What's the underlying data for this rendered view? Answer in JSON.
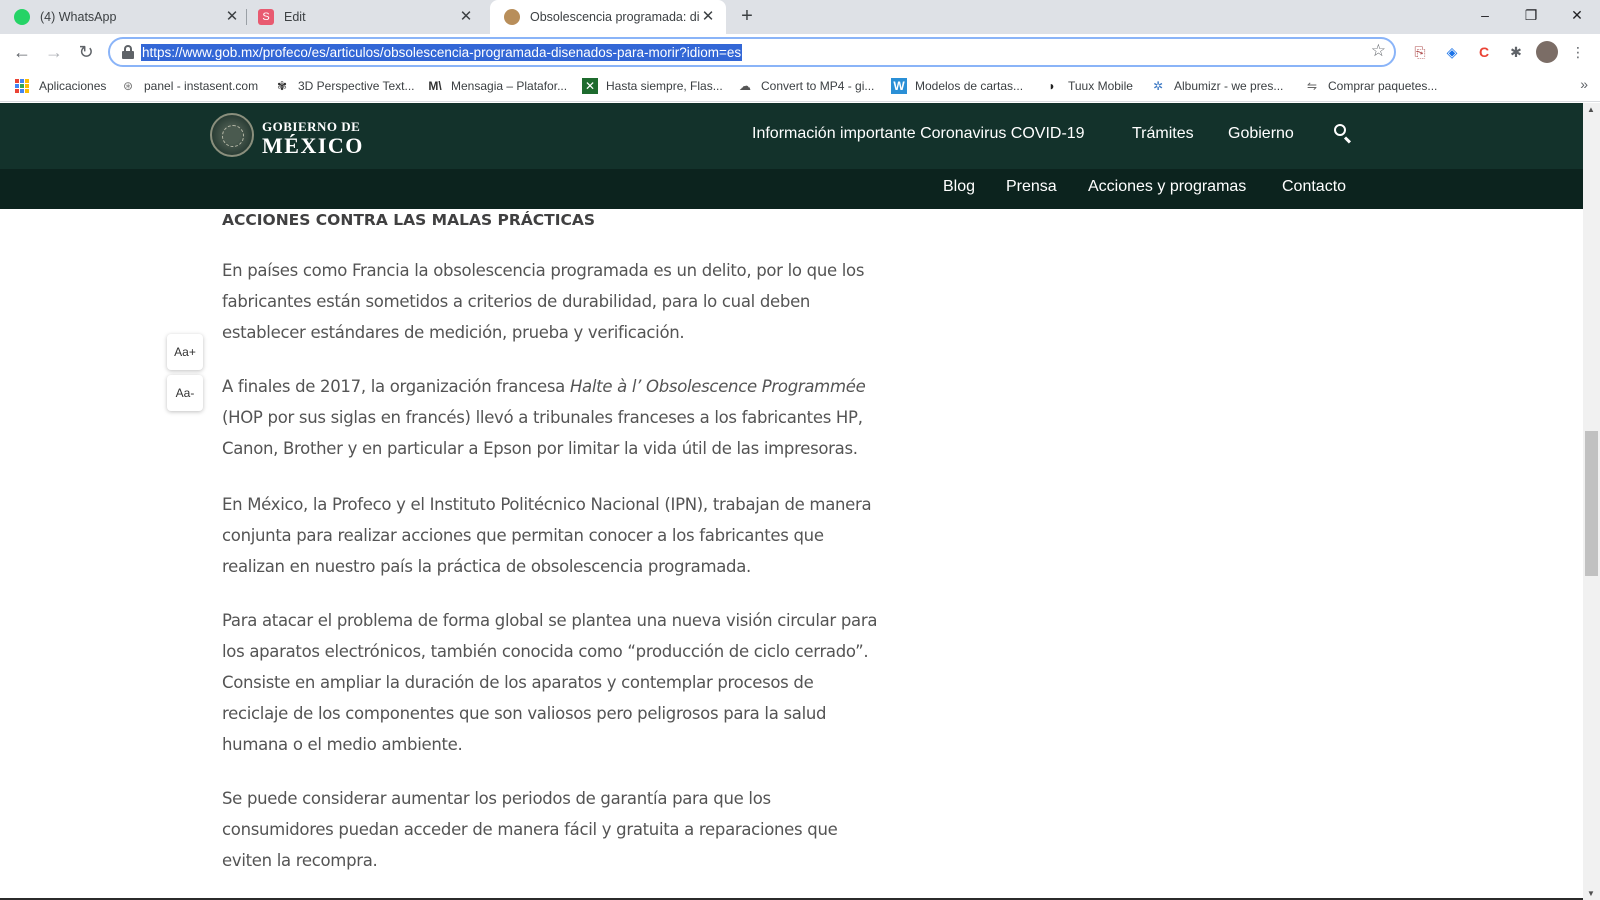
{
  "browser": {
    "tabs": [
      {
        "title": "(4) WhatsApp",
        "icon": "whatsapp-icon",
        "color": "#25d366"
      },
      {
        "title": "Edit",
        "icon": "s-logo-icon",
        "color": "#e85a70"
      },
      {
        "title": "Obsolescencia programada: dise",
        "icon": "profeco-icon",
        "color": "#b88e5a"
      }
    ],
    "new_tab": "+",
    "window_controls": {
      "minimize": "–",
      "restore": "❐",
      "close": "✕"
    },
    "nav": {
      "back": "←",
      "forward": "→",
      "reload": "↻"
    },
    "url": "https://www.gob.mx/profeco/es/articulos/obsolescencia-programada-disenados-para-morir?idiom=es",
    "bookmark_star": "☆",
    "menu": "⋮",
    "bookmarks": [
      "Aplicaciones",
      "panel - instasent.com",
      "3D Perspective Text...",
      "Mensagia – Platafor...",
      "Hasta siempre, Flas...",
      "Convert to MP4 - gi...",
      "Modelos de cartas...",
      "Tuux Mobile",
      "Albumizr - we pres...",
      "Comprar paquetes..."
    ],
    "bookmarks_more": "»"
  },
  "site": {
    "brand_small": "GOBIERNO DE",
    "brand_big": "MÉXICO",
    "top_nav": [
      "Información importante Coronavirus COVID-19",
      "Trámites",
      "Gobierno"
    ],
    "sub_nav": [
      "Blog",
      "Prensa",
      "Acciones y programas",
      "Contacto"
    ],
    "colors": {
      "header": "#13322b",
      "subheader": "#0c231e"
    }
  },
  "article": {
    "heading": "ACCIONES CONTRA LAS MALAS PRÁCTICAS",
    "p1": "En países como Francia la obsolescencia programada es un delito, por lo que los fabricantes están sometidos a criterios de durabilidad, para lo cual deben establecer estándares de medición, prueba y verificación.",
    "p2_before": "A finales de 2017, la organización francesa ",
    "p2_em": "Halte à l’ Obsolescence Programmée",
    "p2_after": " (HOP por sus siglas en francés) llevó a tribunales franceses a los fabricantes HP, Canon, Brother y en particular a Epson por limitar la vida útil de las impresoras.",
    "p3": "En México, la Profeco y el Instituto Politécnico Nacional (IPN), trabajan de manera conjunta para realizar acciones que permitan conocer a los fabricantes que realizan en nuestro país la práctica de obsolescencia programada.",
    "p4": "Para atacar el problema de forma global se plantea una nueva visión circular para los aparatos electrónicos, también conocida como “producción de ciclo cerrado”. Consiste en ampliar la duración de los aparatos y contemplar procesos de reciclaje de los componentes que son valiosos pero peligrosos para la salud humana o el medio ambiente.",
    "p5": "Se puede considerar aumentar los periodos de garantía para que los consumidores puedan acceder de manera fácil y gratuita a reparaciones que eviten la recompra."
  },
  "font_controls": {
    "increase": "Aa+",
    "decrease": "Aa-"
  }
}
